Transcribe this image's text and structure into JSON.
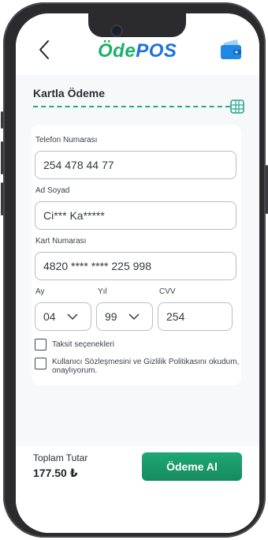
{
  "header": {
    "logo_part1": "Öde",
    "logo_part2": "POS",
    "back_icon": "chevron-left-icon",
    "wallet_icon": "wallet-icon"
  },
  "section": {
    "title": "Kartla Ödeme",
    "card_icon": "card-chip-icon",
    "accent_color": "#22a88a"
  },
  "form": {
    "phone_label": "Telefon Numarası",
    "phone_value": "254 478 44 77",
    "name_label": "Ad Soyad",
    "name_value": "Ci*** Ka*****",
    "card_label": "Kart Numarası",
    "card_value": "4820 **** ****  225 998",
    "month_label": "Ay",
    "month_value": "04",
    "year_label": "Yıl",
    "year_value": "99",
    "cvv_label": "CVV",
    "cvv_value": "254",
    "installment_label": "Taksit seçenekleri",
    "agreement_label_line1": "Kullanıcı Sözleşmesini ve Gizlilik Politikasını okudum,",
    "agreement_label_line2": "onaylıyorum."
  },
  "footer": {
    "total_label": "Toplam Tutar",
    "total_value": "177.50 ₺",
    "pay_button": "Ödeme Al",
    "button_color": "#1ea874"
  }
}
